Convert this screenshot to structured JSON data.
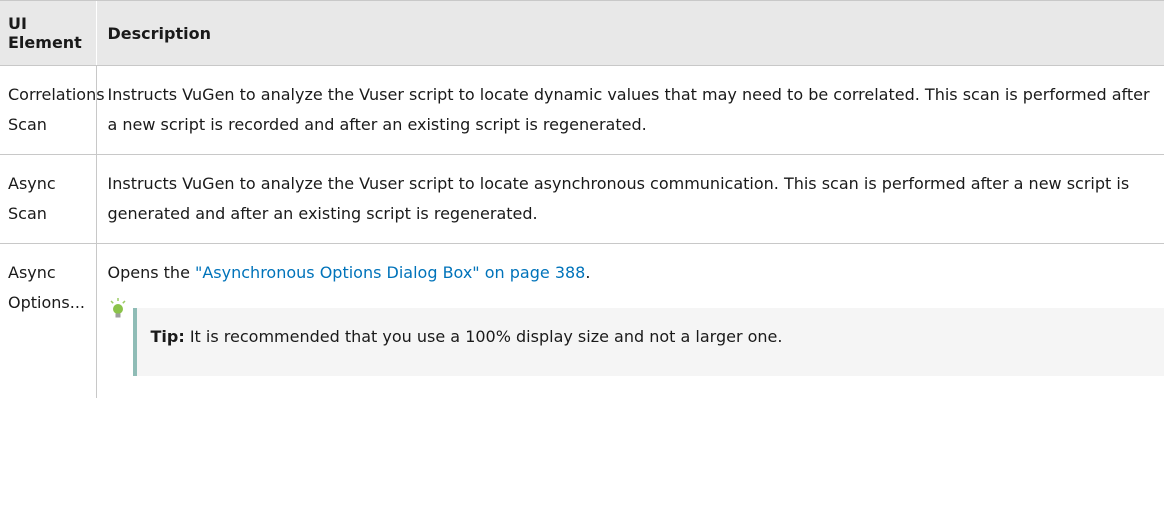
{
  "table": {
    "headers": [
      "UI Element",
      "Description"
    ],
    "rows": [
      {
        "element": "Correlations Scan",
        "description": "Instructs VuGen to analyze the Vuser script to locate dynamic values that may need to be correlated. This scan is performed after a new script is recorded and after an existing script is regenerated."
      },
      {
        "element": "Async Scan",
        "description": "Instructs VuGen to analyze the Vuser script to locate asynchronous communication. This scan is performed after a new script is generated and after an existing script is regenerated."
      },
      {
        "element": "Async Options...",
        "description_prefix": "Opens the ",
        "link_text": "\"Asynchronous Options Dialog Box\" on page 388",
        "description_suffix": ".",
        "tip_label": "Tip:",
        "tip_text": " It is recommended that you use a 100% display size and not a larger one."
      }
    ]
  },
  "icons": {
    "tip": "lightbulb-icon"
  },
  "colors": {
    "link": "#0073ba",
    "tip_border": "#8fbcb6",
    "header_bg": "#e8e8e8"
  }
}
